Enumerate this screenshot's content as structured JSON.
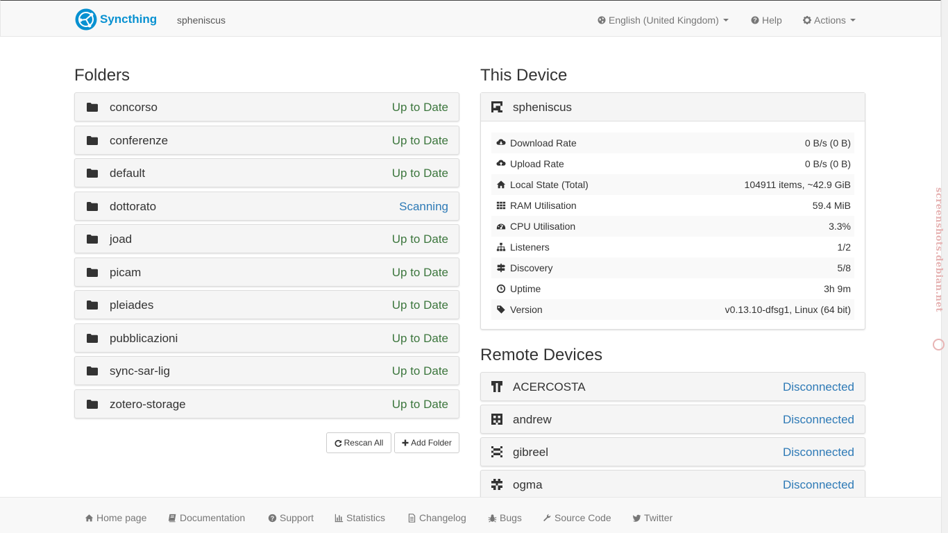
{
  "navbar": {
    "brand": "Syncthing",
    "device_name": "spheniscus",
    "language": "English (United Kingdom)",
    "help": "Help",
    "actions": "Actions"
  },
  "folders": {
    "heading": "Folders",
    "items": [
      {
        "name": "concorso",
        "status": "Up to Date"
      },
      {
        "name": "conferenze",
        "status": "Up to Date"
      },
      {
        "name": "default",
        "status": "Up to Date"
      },
      {
        "name": "dottorato",
        "status": "Scanning"
      },
      {
        "name": "joad",
        "status": "Up to Date"
      },
      {
        "name": "picam",
        "status": "Up to Date"
      },
      {
        "name": "pleiades",
        "status": "Up to Date"
      },
      {
        "name": "pubblicazioni",
        "status": "Up to Date"
      },
      {
        "name": "sync-sar-lig",
        "status": "Up to Date"
      },
      {
        "name": "zotero-storage",
        "status": "Up to Date"
      }
    ],
    "rescan_all": "Rescan All",
    "add_folder": "Add Folder"
  },
  "this_device": {
    "heading": "This Device",
    "name": "spheniscus",
    "stats": [
      {
        "label": "Download Rate",
        "value": "0 B/s (0 B)",
        "icon": "cloud-download-icon"
      },
      {
        "label": "Upload Rate",
        "value": "0 B/s (0 B)",
        "icon": "cloud-upload-icon"
      },
      {
        "label": "Local State (Total)",
        "value": "104911 items, ~42.9 GiB",
        "icon": "home-icon"
      },
      {
        "label": "RAM Utilisation",
        "value": "59.4 MiB",
        "icon": "grid-icon"
      },
      {
        "label": "CPU Utilisation",
        "value": "3.3%",
        "icon": "dashboard-icon"
      },
      {
        "label": "Listeners",
        "value": "1/2",
        "icon": "sitemap-icon"
      },
      {
        "label": "Discovery",
        "value": "5/8",
        "icon": "signpost-icon"
      },
      {
        "label": "Uptime",
        "value": "3h 9m",
        "icon": "clock-icon"
      },
      {
        "label": "Version",
        "value": "v0.13.10-dfsg1, Linux (64 bit)",
        "icon": "tag-icon"
      }
    ]
  },
  "remote_devices": {
    "heading": "Remote Devices",
    "items": [
      {
        "name": "ACERCOSTA",
        "status": "Disconnected"
      },
      {
        "name": "andrew",
        "status": "Disconnected"
      },
      {
        "name": "gibreel",
        "status": "Disconnected"
      },
      {
        "name": "ogma",
        "status": "Disconnected"
      }
    ]
  },
  "footer": {
    "links": [
      "Home page",
      "Documentation",
      "Support",
      "Statistics",
      "Changelog",
      "Bugs",
      "Source Code",
      "Twitter"
    ]
  },
  "watermark": "screenshots.debian.net",
  "colors": {
    "brand": "#0891d1",
    "up_to_date": "#3c763d",
    "scanning": "#2e7ab6",
    "disconnected": "#2e7ab6"
  }
}
